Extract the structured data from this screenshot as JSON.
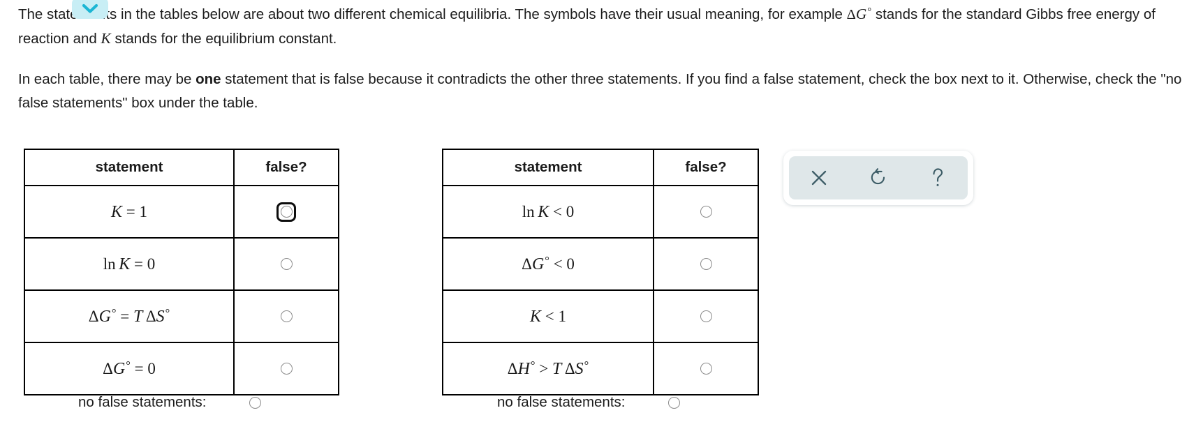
{
  "intro": {
    "paragraph1_parts": [
      "The sta",
      "ts in the tables below are about two different chemical equilibria. The symbols have their usual meaning, for example ",
      " stands for the standard Gibbs free energy of reaction and ",
      " stands for the equilibrium constant."
    ],
    "paragraph1_hidden_word_fragment": "temen",
    "paragraph2_parts": [
      "In each table, there may be ",
      "one",
      " statement that is false because it contradicts the other three statements. If you find a false statement, check the box next to it. Otherwise, check the \"no false statements\" box under the table."
    ],
    "symbol_delta_g": "ΔG°",
    "symbol_k": "K"
  },
  "chevron_badge": {
    "icon": "chevron-down-icon",
    "background_color": "#c8eef5",
    "icon_color": "#1cb6d4"
  },
  "tables": [
    {
      "id": "table-1",
      "headers": [
        "statement",
        "false?"
      ],
      "rows": [
        {
          "statement": "K = 1",
          "checked": false,
          "focused": true
        },
        {
          "statement": "ln K = 0",
          "checked": false,
          "focused": false
        },
        {
          "statement": "ΔG° = T ΔS°",
          "checked": false,
          "focused": false
        },
        {
          "statement": "ΔG° = 0",
          "checked": false,
          "focused": false
        }
      ],
      "no_false_label": "no false statements:"
    },
    {
      "id": "table-2",
      "headers": [
        "statement",
        "false?"
      ],
      "rows": [
        {
          "statement": "ln K < 0",
          "checked": false,
          "focused": false
        },
        {
          "statement": "ΔG° < 0",
          "checked": false,
          "focused": false
        },
        {
          "statement": "K < 1",
          "checked": false,
          "focused": false
        },
        {
          "statement": "ΔH° > T ΔS°",
          "checked": false,
          "focused": false
        }
      ],
      "no_false_label": "no false statements:"
    }
  ],
  "tool_panel": {
    "buttons": [
      {
        "name": "close-icon",
        "label": "×"
      },
      {
        "name": "reset-icon",
        "label": "↺"
      },
      {
        "name": "help-icon",
        "label": "?"
      }
    ],
    "panel_color": "#dfe7e9",
    "icon_color": "#3c5c66"
  }
}
